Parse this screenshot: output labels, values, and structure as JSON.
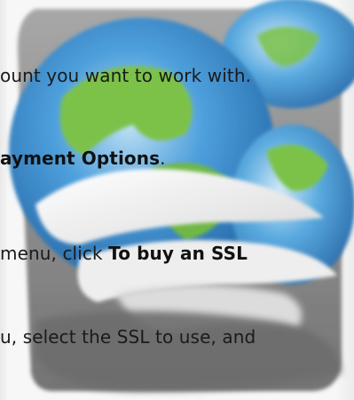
{
  "instructions": {
    "line1": "ount you want to work with.",
    "line2_bold": "ayment Options",
    "line2_end": ".",
    "line3_plain": "menu, click ",
    "line3_bold": "To buy an SSL",
    "line4": "u, select the SSL to use, and"
  },
  "artwork": {
    "icon": "globe-logo-icon",
    "colors": {
      "globe_blue": "#3c8fd0",
      "globe_green": "#7cc24a",
      "ring_white": "#f3f3f3",
      "shadow_gray": "#8a8a8a"
    }
  }
}
